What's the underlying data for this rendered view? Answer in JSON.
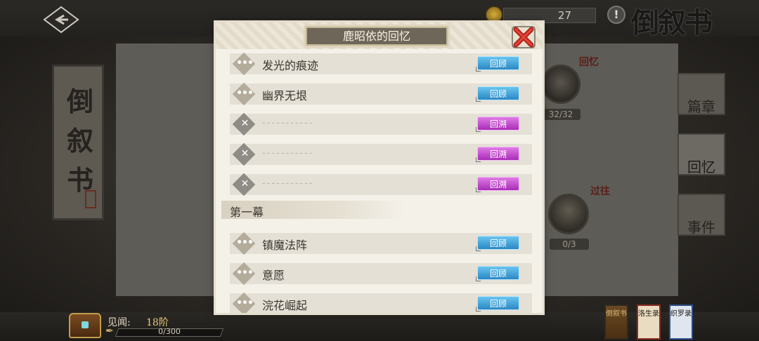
{
  "header": {
    "coin_count": "27",
    "logo": "倒叙书"
  },
  "left_scroll": {
    "text": "倒叙书"
  },
  "right_tabs": [
    {
      "label": "篇章"
    },
    {
      "label": "回忆"
    },
    {
      "label": "事件"
    }
  ],
  "characters": [
    {
      "count": "32/32",
      "tag": "回忆"
    },
    {
      "count": "0/3",
      "tag": "过往"
    }
  ],
  "bottom": {
    "jianwen_label": "见闻:",
    "jianwen_rank": "18阶",
    "xp_text": "0/300"
  },
  "books": [
    {
      "label": "倒叙书"
    },
    {
      "label": "洛生录"
    },
    {
      "label": "织罗录"
    }
  ],
  "modal": {
    "title": "鹿昭依的回忆",
    "items": [
      {
        "label": "发光的痕迹",
        "button": "回顾",
        "locked": false
      },
      {
        "label": "幽界无垠",
        "button": "回顾",
        "locked": false
      },
      {
        "label": "-----------",
        "button": "回溯",
        "locked": true
      },
      {
        "label": "-----------",
        "button": "回溯",
        "locked": true
      },
      {
        "label": "-----------",
        "button": "回溯",
        "locked": true
      }
    ],
    "section": "第一幕",
    "section_items": [
      {
        "label": "镇魔法阵",
        "button": "回顾"
      },
      {
        "label": "意愿",
        "button": "回顾"
      },
      {
        "label": "浣花崛起",
        "button": "回顾"
      }
    ]
  },
  "colors": {
    "review_button": "#3a9ad6",
    "revisit_button": "#c44ed0",
    "modal_bg": "#f4f1e9"
  }
}
